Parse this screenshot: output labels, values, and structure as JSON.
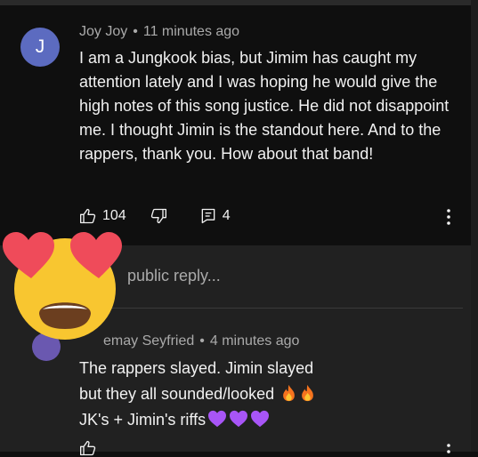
{
  "comment": {
    "avatar_letter": "J",
    "author": "Joy Joy",
    "separator": "•",
    "time": "11 minutes ago",
    "text": "I am a Jungkook bias, but Jimim has caught my attention lately and I was hoping he would give the high notes of this song justice. He did not disappoint me. I thought Jimin is the standout here. And to the rappers, thank you. How about that band!",
    "likes": "104",
    "replies": "4"
  },
  "reply_box": {
    "placeholder": "public reply..."
  },
  "reply": {
    "author": "emay Seyfried",
    "separator": "•",
    "time": "4 minutes ago",
    "line1": "The rappers slayed. Jimin slayed",
    "line2": "but they all sounded/looked",
    "line3": "JK's + Jimin's riffs"
  },
  "colors": {
    "background": "#0f0f0f",
    "reply_background": "#212121",
    "avatar": "#5c6bc0",
    "heart_emoji": "#a855f7",
    "emoji_face": "#f8c630",
    "emoji_hearts": "#ef4b5a"
  },
  "icons": [
    "thumbs-up-icon",
    "thumbs-down-icon",
    "reply-icon",
    "more-vertical-icon",
    "fire-emoji",
    "purple-heart-emoji",
    "heart-eyes-emoji"
  ]
}
